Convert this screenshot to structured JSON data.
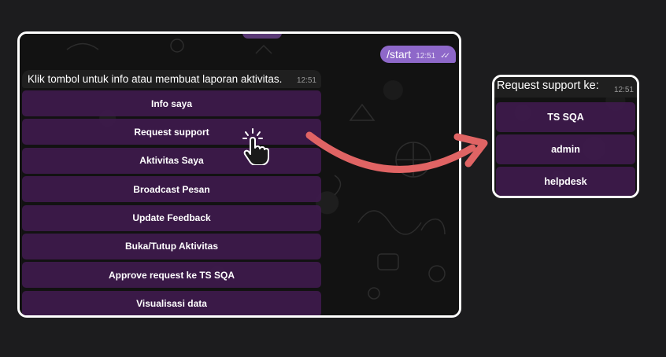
{
  "main_chat": {
    "outgoing": {
      "text": "/start",
      "time": "12:51",
      "status": "read"
    },
    "incoming": {
      "text": "Klik tombol untuk info atau membuat laporan aktivitas.",
      "time": "12:51"
    },
    "keyboard": [
      {
        "label": "Info saya"
      },
      {
        "label": "Request support"
      },
      {
        "label": "Aktivitas Saya"
      },
      {
        "label": "Broadcast Pesan"
      },
      {
        "label": "Update Feedback"
      },
      {
        "label": "Buka/Tutup Aktivitas"
      },
      {
        "label": "Approve request ke TS SQA"
      },
      {
        "label": "Visualisasi data"
      }
    ]
  },
  "support_chat": {
    "incoming": {
      "text": "Request support ke:",
      "time": "12:51"
    },
    "keyboard": [
      {
        "label": "TS SQA"
      },
      {
        "label": "admin"
      },
      {
        "label": "helpdesk"
      }
    ]
  },
  "colors": {
    "button_bg": "#401a4e",
    "outgoing_bubble": "#8e68c9",
    "incoming_bubble": "#1f1f1f",
    "arrow": "#e06464",
    "frame": "#ffffff"
  },
  "icons": [
    "tap-hand-icon",
    "double-check-icon",
    "curved-arrow-icon"
  ]
}
